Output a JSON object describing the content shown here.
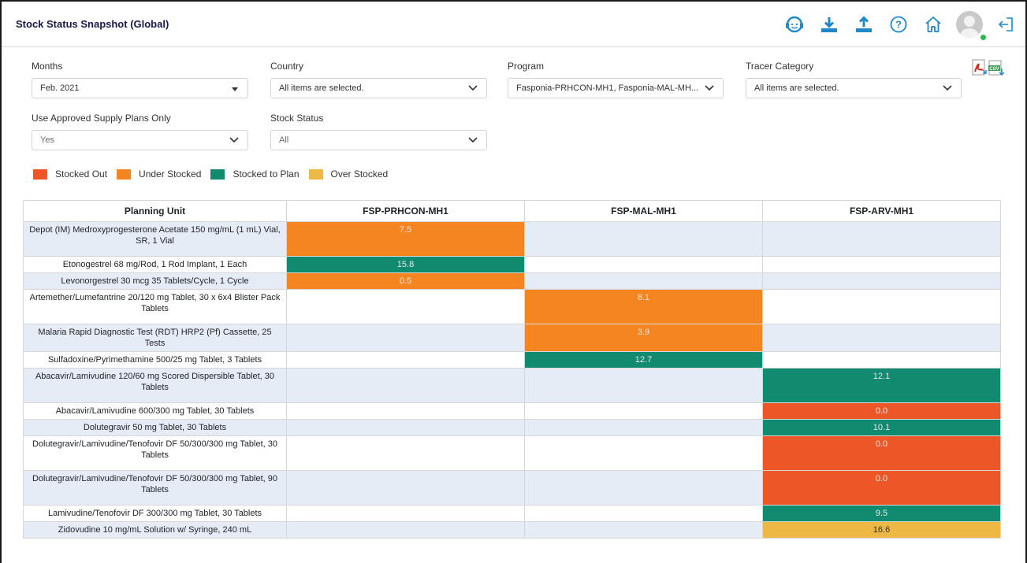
{
  "header": {
    "title": "Stock Status Snapshot (Global)",
    "icons": [
      "support-icon",
      "download-icon",
      "upload-icon",
      "help-icon",
      "home-icon",
      "avatar",
      "logout-icon"
    ]
  },
  "filters": {
    "months": {
      "label": "Months",
      "value": "Feb. 2021"
    },
    "country": {
      "label": "Country",
      "value": "All items are selected."
    },
    "program": {
      "label": "Program",
      "value": "Fasponia-PRHCON-MH1, Fasponia-MAL-MH..."
    },
    "tracer": {
      "label": "Tracer Category",
      "value": "All items are selected."
    },
    "approved": {
      "label": "Use Approved Supply Plans Only",
      "value": "Yes"
    },
    "stock_status": {
      "label": "Stock Status",
      "value": "All"
    }
  },
  "exports": [
    "pdf-export-icon",
    "csv-export-icon"
  ],
  "legend": [
    {
      "label": "Stocked Out",
      "color": "#ed5626"
    },
    {
      "label": "Under Stocked",
      "color": "#f48521"
    },
    {
      "label": "Stocked to Plan",
      "color": "#118b70"
    },
    {
      "label": "Over Stocked",
      "color": "#edb944"
    }
  ],
  "table": {
    "headers": [
      "Planning Unit",
      "FSP-PRHCON-MH1",
      "FSP-MAL-MH1",
      "FSP-ARV-MH1"
    ],
    "rows": [
      {
        "unit": "Depot (IM) Medroxyprogesterone Acetate 150 mg/mL (1 mL) Vial, SR, 1 Vial",
        "prh": "7.5",
        "mal": "",
        "arv": ""
      },
      {
        "unit": "Etonogestrel 68 mg/Rod, 1 Rod Implant, 1 Each",
        "prh": "15.8",
        "mal": "",
        "arv": ""
      },
      {
        "unit": "Levonorgestrel 30 mcg 35 Tablets/Cycle, 1 Cycle",
        "prh": "0.5",
        "mal": "",
        "arv": ""
      },
      {
        "unit": "Artemether/Lumefantrine 20/120 mg Tablet, 30 x 6x4 Blister Pack Tablets",
        "prh": "",
        "mal": "8.1",
        "arv": ""
      },
      {
        "unit": "Malaria Rapid Diagnostic Test (RDT) HRP2 (Pf) Cassette, 25 Tests",
        "prh": "",
        "mal": "3.9",
        "arv": ""
      },
      {
        "unit": "Sulfadoxine/Pyrimethamine 500/25 mg Tablet, 3 Tablets",
        "prh": "",
        "mal": "12.7",
        "arv": ""
      },
      {
        "unit": "Abacavir/Lamivudine 120/60 mg Scored Dispersible Tablet, 30 Tablets",
        "prh": "",
        "mal": "",
        "arv": "12.1"
      },
      {
        "unit": "Abacavir/Lamivudine 600/300 mg Tablet, 30 Tablets",
        "prh": "",
        "mal": "",
        "arv": "0.0"
      },
      {
        "unit": "Dolutegravir 50 mg Tablet, 30 Tablets",
        "prh": "",
        "mal": "",
        "arv": "10.1"
      },
      {
        "unit": "Dolutegravir/Lamivudine/Tenofovir DF 50/300/300 mg Tablet, 30 Tablets",
        "prh": "",
        "mal": "",
        "arv": "0.0"
      },
      {
        "unit": "Dolutegravir/Lamivudine/Tenofovir DF 50/300/300 mg Tablet, 90 Tablets",
        "prh": "",
        "mal": "",
        "arv": "0.0"
      },
      {
        "unit": "Lamivudine/Tenofovir DF 300/300 mg Tablet, 30 Tablets",
        "prh": "",
        "mal": "",
        "arv": "9.5"
      },
      {
        "unit": "Zidovudine 10 mg/mL Solution w/ Syringe, 240 mL",
        "prh": "",
        "mal": "",
        "arv": "16.6"
      }
    ]
  }
}
